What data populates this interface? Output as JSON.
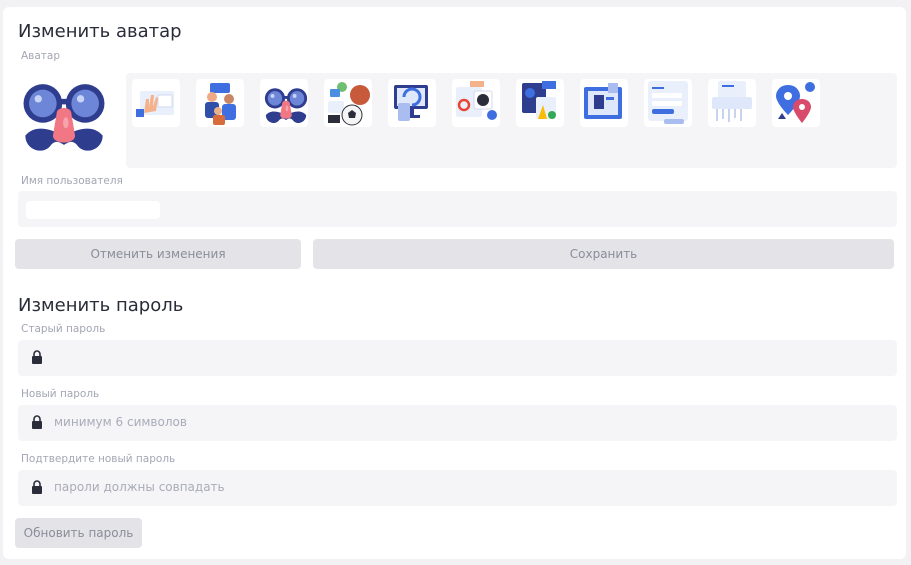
{
  "avatar_section": {
    "title": "Изменить аватар",
    "avatar_label": "Аватар",
    "current_avatar": "glasses-mustache-disguise-icon",
    "gallery": [
      "hand-waving-web-page-icon",
      "developers-team-icon",
      "glasses-mustache-disguise-icon",
      "sports-balls-icon",
      "monitor-refresh-icon",
      "google-ads-icon",
      "social-ads-icon",
      "website-builder-icon",
      "login-form-icon",
      "document-shredder-icon",
      "location-pins-icon"
    ]
  },
  "username": {
    "label": "Имя пользователя",
    "value": ""
  },
  "profile_buttons": {
    "cancel_label": "Отменить изменения",
    "save_label": "Сохранить"
  },
  "password_section": {
    "title": "Изменить пароль",
    "old_password": {
      "label": "Старый пароль",
      "placeholder": ""
    },
    "new_password": {
      "label": "Новый пароль",
      "placeholder": "минимум 6 символов"
    },
    "confirm_password": {
      "label": "Подтвердите новый пароль",
      "placeholder": "пароли должны совпадать"
    },
    "update_label": "Обновить пароль"
  },
  "colors": {
    "card_bg": "#ffffff",
    "field_bg": "#f5f5f8",
    "button_bg": "#e3e3e8",
    "lock": "#2b2d3a",
    "accent_blue": "#3e6ee0"
  }
}
